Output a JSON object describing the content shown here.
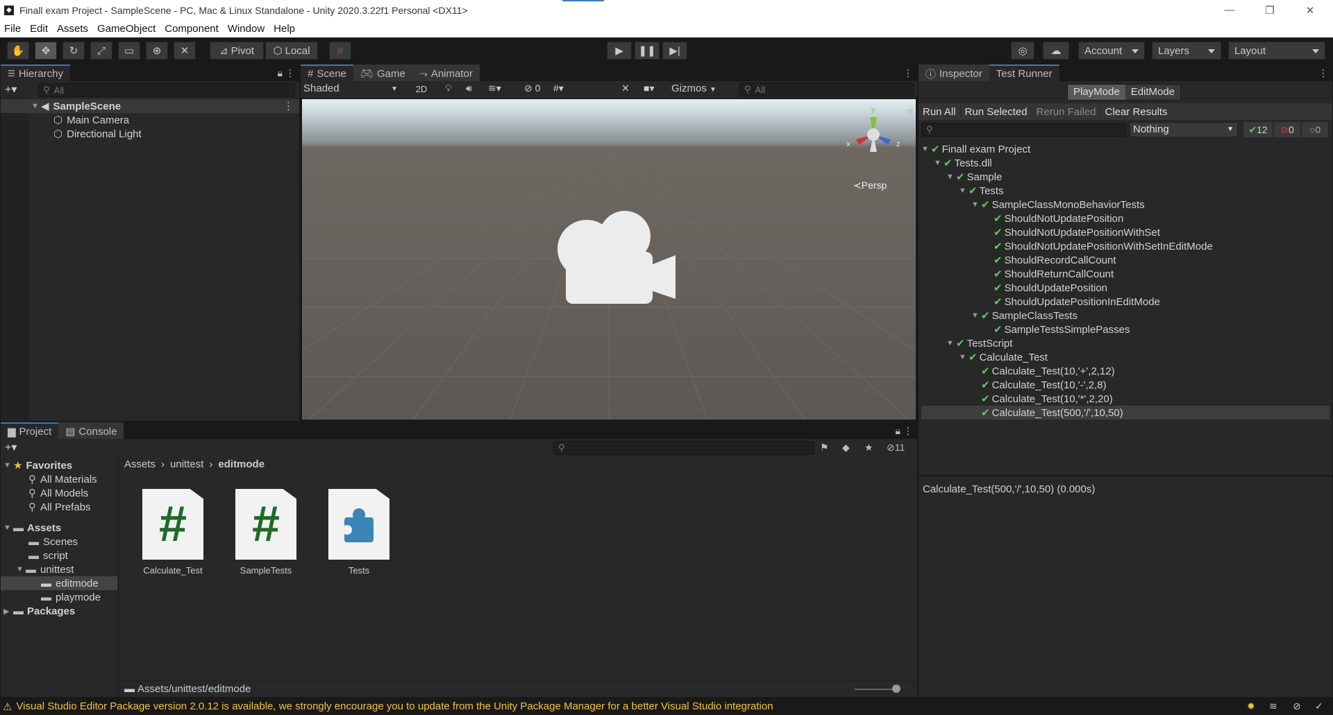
{
  "window": {
    "title": "Finall exam Project - SampleScene - PC, Mac & Linux Standalone - Unity 2020.3.22f1 Personal <DX11>",
    "minimize": "—",
    "maximize": "❐",
    "close": "✕"
  },
  "menu": [
    "File",
    "Edit",
    "Assets",
    "GameObject",
    "Component",
    "Window",
    "Help"
  ],
  "toolbar": {
    "pivot": "Pivot",
    "local": "Local",
    "account": "Account",
    "layers": "Layers",
    "layout": "Layout"
  },
  "hierarchy": {
    "tab": "Hierarchy",
    "search_placeholder": "All",
    "scene": "SampleScene",
    "objects": [
      "Main Camera",
      "Directional Light"
    ]
  },
  "scene_view": {
    "tabs": [
      "Scene",
      "Game",
      "Animator"
    ],
    "shading": "Shaded",
    "mode2d": "2D",
    "hidden_count": "0",
    "gizmos": "Gizmos",
    "search_placeholder": "All",
    "projection": "Persp",
    "axis_x": "x",
    "axis_y": "y",
    "axis_z": "z"
  },
  "project": {
    "tabs": [
      "Project",
      "Console"
    ],
    "hidden_count": "11",
    "favorites_label": "Favorites",
    "favorites": [
      "All Materials",
      "All Models",
      "All Prefabs"
    ],
    "assets_label": "Assets",
    "asset_folders": [
      "Scenes",
      "script",
      "unittest"
    ],
    "unittest_folders": [
      "editmode",
      "playmode"
    ],
    "packages_label": "Packages",
    "breadcrumb": [
      "Assets",
      "unittest",
      "editmode"
    ],
    "files": [
      {
        "name": "Calculate_Test",
        "icon": "csharp-script-icon"
      },
      {
        "name": "SampleTests",
        "icon": "csharp-script-icon"
      },
      {
        "name": "Tests",
        "icon": "assembly-definition-icon"
      }
    ],
    "footer_path": "Assets/unittest/editmode"
  },
  "right_panel": {
    "tabs": [
      "Inspector",
      "Test Runner"
    ],
    "mode_tabs": [
      "PlayMode",
      "EditMode"
    ],
    "actions": [
      "Run All",
      "Run Selected",
      "Rerun Failed",
      "Clear Results"
    ],
    "category_filter": "Nothing",
    "passed_count": "12",
    "failed_count": "0",
    "skipped_count": "0",
    "tree": [
      {
        "label": "Finall exam Project",
        "level": 0,
        "arrow": true
      },
      {
        "label": "Tests.dll",
        "level": 1,
        "arrow": true
      },
      {
        "label": "Sample",
        "level": 2,
        "arrow": true
      },
      {
        "label": "Tests",
        "level": 3,
        "arrow": true
      },
      {
        "label": "SampleClassMonoBehaviorTests",
        "level": 4,
        "arrow": true
      },
      {
        "label": "ShouldNotUpdatePosition",
        "level": 5,
        "arrow": false
      },
      {
        "label": "ShouldNotUpdatePositionWithSet",
        "level": 5,
        "arrow": false
      },
      {
        "label": "ShouldNotUpdatePositionWithSetInEditMode",
        "level": 5,
        "arrow": false
      },
      {
        "label": "ShouldRecordCallCount",
        "level": 5,
        "arrow": false
      },
      {
        "label": "ShouldReturnCallCount",
        "level": 5,
        "arrow": false
      },
      {
        "label": "ShouldUpdatePosition",
        "level": 5,
        "arrow": false
      },
      {
        "label": "ShouldUpdatePositionInEditMode",
        "level": 5,
        "arrow": false
      },
      {
        "label": "SampleClassTests",
        "level": 4,
        "arrow": true
      },
      {
        "label": "SampleTestsSimplePasses",
        "level": 5,
        "arrow": false
      },
      {
        "label": "TestScript",
        "level": 2,
        "arrow": true
      },
      {
        "label": "Calculate_Test",
        "level": 3,
        "arrow": true
      },
      {
        "label": "Calculate_Test(10,'+',2,12)",
        "level": 4,
        "arrow": false
      },
      {
        "label": "Calculate_Test(10,'-',2,8)",
        "level": 4,
        "arrow": false
      },
      {
        "label": "Calculate_Test(10,'*',2,20)",
        "level": 4,
        "arrow": false
      },
      {
        "label": "Calculate_Test(500,'/',10,50)",
        "level": 4,
        "arrow": false,
        "selected": true
      }
    ],
    "result_text": "Calculate_Test(500,'/',10,50) (0.000s)"
  },
  "status_bar": {
    "message": "Visual Studio Editor Package version 2.0.12 is available, we strongly encourage you to update from the Unity Package Manager for a better Visual Studio integration"
  },
  "colors": {
    "accent": "#3a79bb",
    "pass": "#5fcb5a",
    "warning": "#f4c430"
  }
}
